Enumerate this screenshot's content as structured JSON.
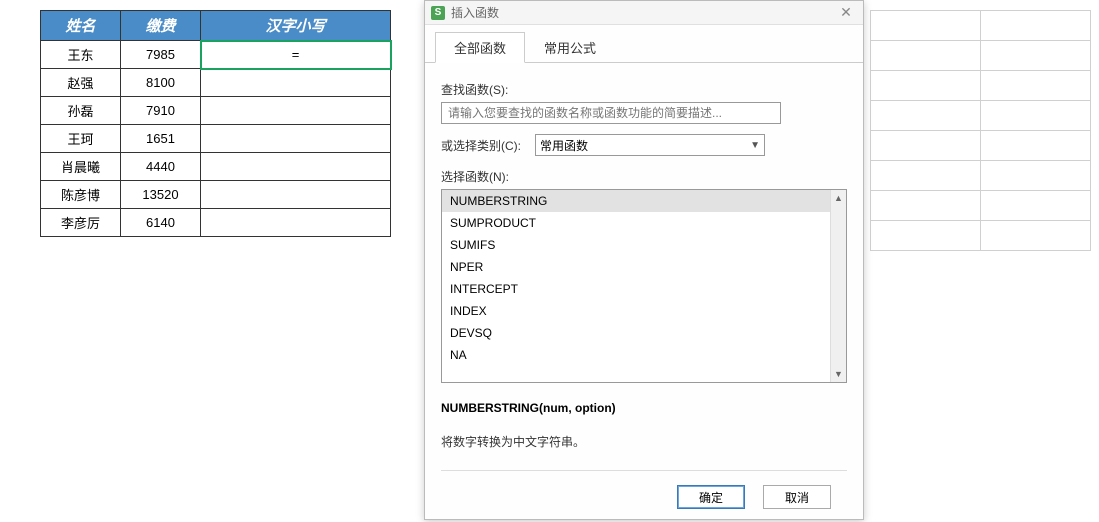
{
  "sheet": {
    "headers": {
      "name": "姓名",
      "fee": "缴费",
      "cn": "汉字小写"
    },
    "rows": [
      {
        "name": "王东",
        "fee": "7985",
        "cn": "="
      },
      {
        "name": "赵强",
        "fee": "8100",
        "cn": ""
      },
      {
        "name": "孙磊",
        "fee": "7910",
        "cn": ""
      },
      {
        "name": "王珂",
        "fee": "1651",
        "cn": ""
      },
      {
        "name": "肖晨曦",
        "fee": "4440",
        "cn": ""
      },
      {
        "name": "陈彦博",
        "fee": "13520",
        "cn": ""
      },
      {
        "name": "李彦厉",
        "fee": "6140",
        "cn": ""
      }
    ]
  },
  "dialog": {
    "app_icon_letter": "S",
    "title": "插入函数",
    "tabs": {
      "all": "全部函数",
      "common": "常用公式"
    },
    "labels": {
      "search": "查找函数(S):",
      "category": "或选择类别(C):",
      "select_fn": "选择函数(N):"
    },
    "search_placeholder": "请输入您要查找的函数名称或函数功能的简要描述...",
    "category_value": "常用函数",
    "functions": [
      "NUMBERSTRING",
      "SUMPRODUCT",
      "SUMIFS",
      "NPER",
      "INTERCEPT",
      "INDEX",
      "DEVSQ",
      "NA"
    ],
    "signature": "NUMBERSTRING(num, option)",
    "description": "将数字转换为中文字符串。",
    "buttons": {
      "ok": "确定",
      "cancel": "取消"
    }
  }
}
